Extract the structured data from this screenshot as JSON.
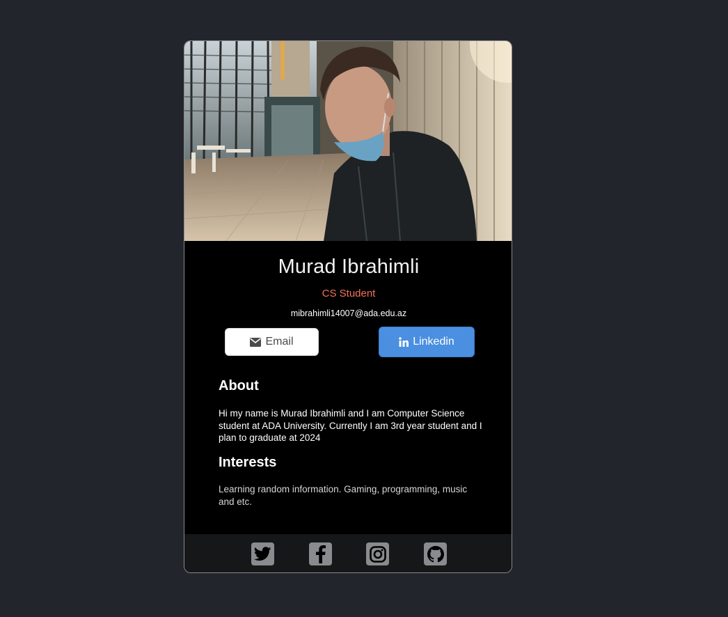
{
  "profile": {
    "name": "Murad Ibrahimli",
    "role": "CS Student",
    "email": "mibrahimli14007@ada.edu.az",
    "photo_icon": "profile-photo"
  },
  "buttons": {
    "email_label": "Email",
    "email_icon": "envelope-icon",
    "linkedin_label": "Linkedin",
    "linkedin_icon": "linkedin-icon"
  },
  "about": {
    "title": "About",
    "text": "Hi my name is Murad Ibrahimli and I am Computer Science student at ADA University. Currently I am 3rd year student and I plan to graduate at 2024"
  },
  "interests": {
    "title": "Interests",
    "text": "Learning random information. Gaming, programming, music and etc."
  },
  "footer": {
    "socials": [
      "twitter-icon",
      "facebook-icon",
      "instagram-icon",
      "github-icon"
    ]
  },
  "colors": {
    "background": "#23252c",
    "card": "#000000",
    "role": "#f3725a",
    "linkedin_button": "#4a8fe0",
    "footer": "#161719",
    "social_tile": "#8a8b8e"
  }
}
